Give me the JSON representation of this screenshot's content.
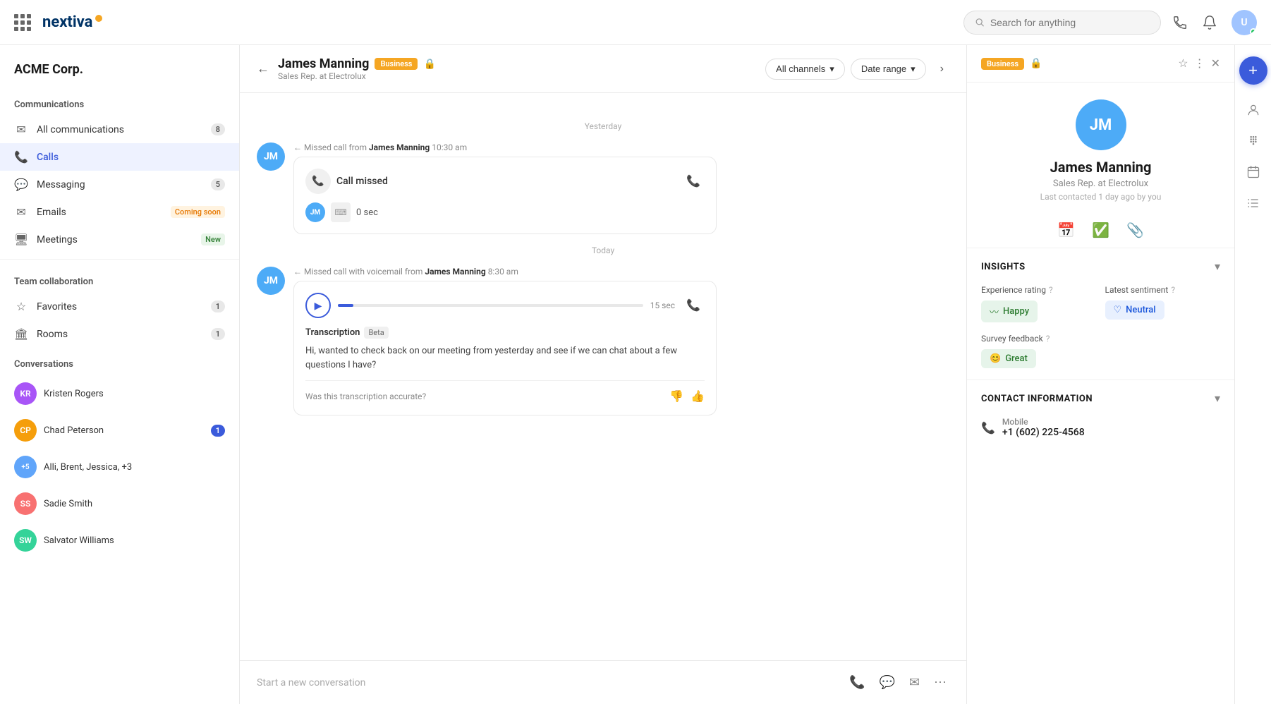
{
  "app": {
    "logo_text": "nextiva",
    "search_placeholder": "Search for anything"
  },
  "sidebar": {
    "company": "ACME Corp.",
    "communications_label": "Communications",
    "items": [
      {
        "id": "all-communications",
        "label": "All communications",
        "badge": "8",
        "icon": "✉"
      },
      {
        "id": "calls",
        "label": "Calls",
        "badge": "",
        "icon": "📞",
        "active": true
      },
      {
        "id": "messaging",
        "label": "Messaging",
        "badge": "5",
        "icon": "💬"
      },
      {
        "id": "emails",
        "label": "Emails",
        "badge": "",
        "icon": "✉",
        "tag": "Coming soon"
      },
      {
        "id": "meetings",
        "label": "Meetings",
        "badge": "",
        "icon": "🖥",
        "tag": "New"
      }
    ],
    "team_label": "Team collaboration",
    "team_items": [
      {
        "id": "favorites",
        "label": "Favorites",
        "badge": "1",
        "icon": "☆"
      },
      {
        "id": "rooms",
        "label": "Rooms",
        "badge": "1",
        "icon": "🏛"
      }
    ],
    "conversations_label": "Conversations",
    "conversations": [
      {
        "id": "kristen",
        "name": "Kristen Rogers",
        "color": "#e879f9",
        "badge": ""
      },
      {
        "id": "chad",
        "name": "Chad Peterson",
        "color": "#f59e0b",
        "badge": "1"
      },
      {
        "id": "alli",
        "name": "Alli, Brent, Jessica, +3",
        "color": "#60a5fa",
        "badge": ""
      },
      {
        "id": "sadie",
        "name": "Sadie Smith",
        "color": "#f87171",
        "badge": ""
      },
      {
        "id": "salvator",
        "name": "Salvator Williams",
        "color": "#34d399",
        "badge": ""
      }
    ]
  },
  "chat": {
    "back_label": "←",
    "contact_name": "James Manning",
    "contact_tag": "Business",
    "contact_role": "Sales Rep. at Electrolux",
    "filter_channels": "All channels",
    "filter_date": "Date range",
    "date_divider_yesterday": "Yesterday",
    "date_divider_today": "Today",
    "missed_call_label": "Missed call from",
    "missed_caller": "James Manning",
    "missed_time1": "10:30 am",
    "missed_call_text": "Call missed",
    "call_duration": "0 sec",
    "voicemail_missed_label": "Missed call with voicemail from",
    "voicemail_caller": "James Manning",
    "voicemail_time": "8:30 am",
    "audio_duration": "15 sec",
    "transcription_label": "Transcription",
    "transcription_badge": "Beta",
    "transcription_text": "Hi, wanted to check back on our meeting from yesterday and see if we can chat about a few questions I have?",
    "feedback_question": "Was this transcription accurate?",
    "input_placeholder": "Start a new conversation"
  },
  "right_panel": {
    "tag": "Business",
    "avatar_initials": "JM",
    "contact_name": "James Manning",
    "contact_role": "Sales Rep. at Electrolux",
    "last_contacted": "Last contacted 1 day ago by you",
    "insights_title": "INSIGHTS",
    "experience_rating_label": "Experience rating",
    "latest_sentiment_label": "Latest sentiment",
    "happy_label": "Happy",
    "neutral_label": "Neutral",
    "survey_feedback_label": "Survey feedback",
    "great_label": "Great",
    "contact_info_title": "CONTACT INFORMATION",
    "mobile_label": "Mobile",
    "mobile_number": "+1 (602) 225-4568"
  }
}
